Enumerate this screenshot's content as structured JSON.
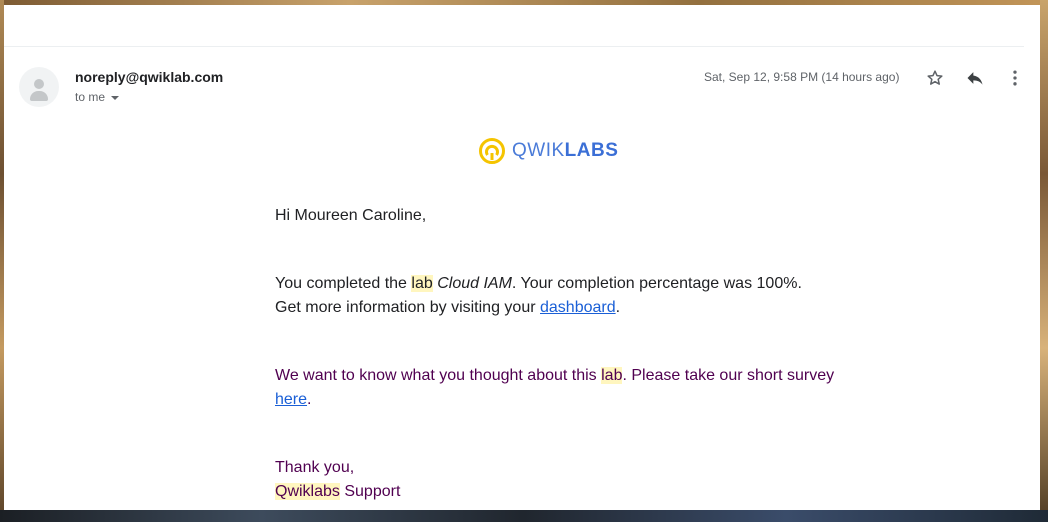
{
  "header": {
    "sender": "noreply@qwiklab.com",
    "recipient": "to me",
    "date": "Sat, Sep 12, 9:58 PM (14 hours ago)",
    "icons": [
      "star-icon",
      "reply-icon",
      "more-vert-icon"
    ]
  },
  "logo": {
    "part1": "QWIK",
    "part2": "LABS",
    "accent_color": "#f5c400",
    "text_color": "#4a7bd8"
  },
  "body": {
    "greeting": "Hi Moureen Caroline,",
    "completed": {
      "prefix": "You completed the ",
      "hl_word": "lab",
      "space": " ",
      "lab_name": "Cloud IAM",
      "suffix": ". Your completion percentage was 100%.",
      "line2_prefix": "Get more information by visiting your ",
      "dashboard_link": "dashboard",
      "period": "."
    },
    "survey": {
      "prefix": "We want to know what you thought about this ",
      "hl_word": "lab",
      "suffix": ". Please take our short survey ",
      "link": "here",
      "period": "."
    },
    "closing": {
      "thanks": "Thank you,",
      "signature_hl": "Qwiklabs",
      "signature_rest": " Support"
    }
  },
  "colors": {
    "link": "#1a5fd6",
    "quoted_text": "#500050",
    "highlight": "#fff6bf"
  }
}
